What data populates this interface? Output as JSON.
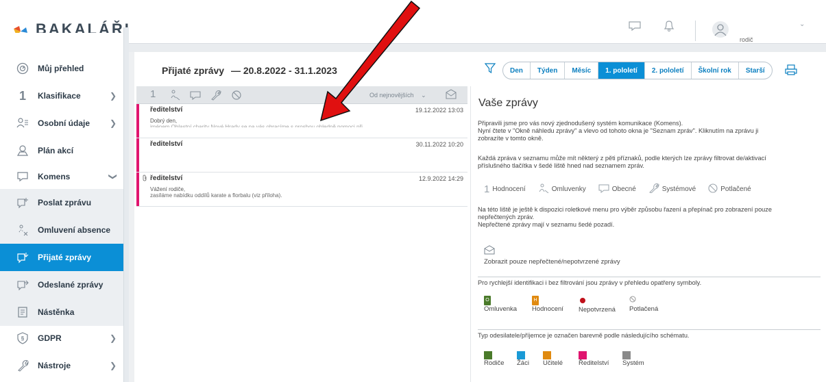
{
  "brand": {
    "name": "BAKALÁŘI"
  },
  "user": {
    "role": "rodič"
  },
  "sidebar": {
    "items": [
      {
        "label": "Můj přehled",
        "icon": "gauge-icon"
      },
      {
        "label": "Klasifikace",
        "icon": "grade-one-icon"
      },
      {
        "label": "Osobní údaje",
        "icon": "people-icon"
      },
      {
        "label": "Plán akcí",
        "icon": "map-pin-icon"
      },
      {
        "label": "Komens",
        "icon": "chat-icon"
      },
      {
        "label": "Poslat zprávu",
        "icon": "compose-message-icon"
      },
      {
        "label": "Omluvení absence",
        "icon": "excuse-icon"
      },
      {
        "label": "Přijaté zprávy",
        "icon": "inbox-icon"
      },
      {
        "label": "Odeslané zprávy",
        "icon": "sent-icon"
      },
      {
        "label": "Nástěnka",
        "icon": "noticeboard-icon"
      },
      {
        "label": "GDPR",
        "icon": "shield-icon"
      },
      {
        "label": "Nástroje",
        "icon": "wrench-icon"
      }
    ]
  },
  "main": {
    "title": "Přijaté zprávy",
    "range": "— 20.8.2022 - 31.1.2023",
    "periods": [
      "Den",
      "Týden",
      "Měsíc",
      "1. pololetí",
      "2. pololetí",
      "Školní rok",
      "Starší"
    ],
    "active_period": "1. pololetí",
    "sort": "Od nejnovějších"
  },
  "messages": [
    {
      "sender": "ředitelství",
      "date": "19.12.2022 13:03",
      "line1": "Dobrý den,",
      "line2": "jménem Oblastní charity Nové Hrady se na vás obracíme s prosbou ohledně pomoci při...",
      "attachment": false
    },
    {
      "sender": "ředitelství",
      "date": "30.11.2022 10:20",
      "line1": "",
      "line2": "",
      "attachment": false
    },
    {
      "sender": "ředitelství",
      "date": "12.9.2022 14:29",
      "line1": "Vážení rodiče,",
      "line2": "zasíláme nabídku oddílů karate a florbalu (viz příloha).",
      "attachment": true
    }
  ],
  "preview": {
    "title": "Vaše zprávy",
    "p1a": "Připravili jsme pro vás nový zjednodušený systém komunikace (Komens).",
    "p1b": "Nyní čtete v \"Okně náhledu zprávy\" a vlevo od tohoto okna je \"Seznam zpráv\". Kliknutím na zprávu ji",
    "p1c": "zobrazíte v tomto okně.",
    "p2a": "Každá zpráva v seznamu může mít některý z pěti příznaků, podle kterých lze zprávy filtrovat de/aktivací",
    "p2b": "příslušného tlačítka v šedé liště hned nad seznamem zpráv.",
    "flags": [
      "Hodnocení",
      "Omluvenky",
      "Obecné",
      "Systémové",
      "Potlačené"
    ],
    "p3a": "Na této liště je ještě k dispozici roletkové menu pro výběr způsobu řazení a přepínač pro zobrazení pouze",
    "p3b": "nepřečtených zpráv.",
    "p3c": "Nepřečtené zprávy mají v seznamu šedé pozadí.",
    "unread_label": "Zobrazit pouze nepřečtené/nepotvrzené zprávy",
    "p4": "Pro rychlejší identifikaci i bez filtrování jsou zprávy v přehledu opatřeny symboly.",
    "symbols": [
      "Omluvenka",
      "Hodnocení",
      "Nepotvrzená",
      "Potlačená"
    ],
    "p5": "Typ odesilatele/příjemce je označen barevně podle následujícího schématu.",
    "senders": [
      {
        "label": "Rodiče",
        "color": "#4a7a2a"
      },
      {
        "label": "Žáci",
        "color": "#1a9ad6"
      },
      {
        "label": "Učitelé",
        "color": "#e08a10"
      },
      {
        "label": "Ředitelství",
        "color": "#e0156f"
      },
      {
        "label": "Systém",
        "color": "#8a8a8a"
      }
    ]
  },
  "colors": {
    "accent": "#0b8fd6",
    "annotation_arrow": "#e01010"
  }
}
